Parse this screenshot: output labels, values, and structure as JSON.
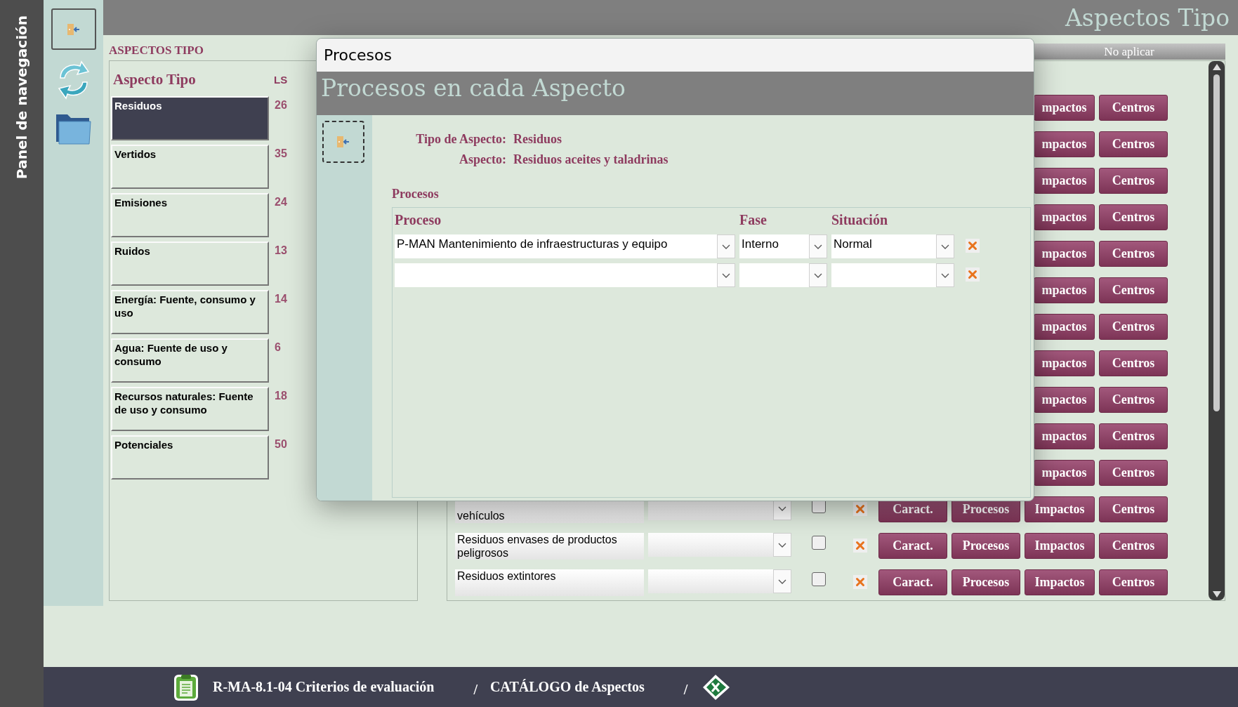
{
  "nav_panel": {
    "title": "Panel de navegación"
  },
  "header": {
    "title": "Aspectos Tipo"
  },
  "aspect_types": {
    "heading": "ASPECTOS TIPO",
    "columns": [
      "Aspecto Tipo",
      "LS"
    ],
    "items": [
      {
        "name": "Residuos",
        "ls": "26",
        "selected": true
      },
      {
        "name": "Vertidos",
        "ls": "35",
        "selected": false
      },
      {
        "name": "Emisiones",
        "ls": "24",
        "selected": false
      },
      {
        "name": "Ruidos",
        "ls": "13",
        "selected": false
      },
      {
        "name": "Energía: Fuente, consumo y uso",
        "ls": "14",
        "selected": false
      },
      {
        "name": "Agua: Fuente  de uso y consumo",
        "ls": "6",
        "selected": false
      },
      {
        "name": "Recursos naturales: Fuente de uso  y consumo",
        "ls": "18",
        "selected": false
      },
      {
        "name": "Potenciales",
        "ls": "50",
        "selected": false
      }
    ]
  },
  "aspects_table": {
    "columns": [
      "No aplicar"
    ],
    "rows": [
      {
        "kind": "covered",
        "impacts": "mpactos",
        "centers": "Centros"
      },
      {
        "kind": "covered",
        "impacts": "mpactos",
        "centers": "Centros"
      },
      {
        "kind": "covered",
        "impacts": "mpactos",
        "centers": "Centros"
      },
      {
        "kind": "covered",
        "impacts": "mpactos",
        "centers": "Centros"
      },
      {
        "kind": "covered",
        "impacts": "mpactos",
        "centers": "Centros"
      },
      {
        "kind": "covered",
        "impacts": "mpactos",
        "centers": "Centros"
      },
      {
        "kind": "covered",
        "impacts": "mpactos",
        "centers": "Centros"
      },
      {
        "kind": "covered",
        "impacts": "mpactos",
        "centers": "Centros"
      },
      {
        "kind": "covered",
        "impacts": "mpactos",
        "centers": "Centros"
      },
      {
        "kind": "covered",
        "impacts": "mpactos",
        "centers": "Centros"
      },
      {
        "kind": "covered",
        "impacts": "mpactos",
        "centers": "Centros"
      },
      {
        "kind": "partial",
        "name": "vehículos",
        "checked": false,
        "caract": "Caract.",
        "processes": "Procesos",
        "impacts": "Impactos",
        "centers": "Centros"
      },
      {
        "kind": "full",
        "name": "Residuos envases de productos peligrosos",
        "checked": false,
        "caract": "Caract.",
        "processes": "Procesos",
        "impacts": "Impactos",
        "centers": "Centros"
      },
      {
        "kind": "full",
        "name": "Residuos extintores",
        "checked": false,
        "caract": "Caract.",
        "processes": "Procesos",
        "impacts": "Impactos",
        "centers": "Centros"
      }
    ]
  },
  "dialog": {
    "title": "Procesos",
    "heading": "Procesos en cada Aspecto",
    "fields": [
      {
        "label": "Tipo de Aspecto:",
        "value": "Residuos"
      },
      {
        "label": "Aspecto:",
        "value": "Residuos aceites y taladrinas"
      }
    ],
    "section": "Procesos",
    "columns": [
      "Proceso",
      "Fase",
      "Situación"
    ],
    "rows": [
      {
        "kind": "record",
        "process": "P-MAN Mantenimiento de infraestructuras y equipo",
        "phase": "Interno",
        "situation": "Normal"
      },
      {
        "kind": "new"
      }
    ]
  },
  "footer": {
    "items": [
      {
        "kind": "document",
        "text": "R-MA-8.1-04 Criterios de evaluación"
      },
      {
        "kind": "separator",
        "text": "/"
      },
      {
        "kind": "document",
        "text": "CATÁLOGO de Aspectos"
      },
      {
        "kind": "separator",
        "text": "/"
      }
    ]
  }
}
